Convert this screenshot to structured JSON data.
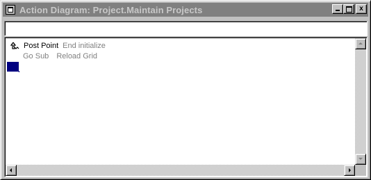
{
  "window": {
    "title": "Action Diagram: Project.Maintain Projects",
    "system_menu_icon": "window-system-menu-icon",
    "controls": {
      "minimize_icon": "minimize-icon",
      "maximize_icon": "maximize-icon",
      "close_label": "x"
    }
  },
  "command_input": {
    "value": "",
    "placeholder": ""
  },
  "diagram": {
    "lines": [
      {
        "icon": "post-point-arrow-icon",
        "command": "Post Point",
        "argument": "End initialize"
      },
      {
        "icon": "",
        "command": "Go Sub",
        "argument": "Reload Grid"
      }
    ],
    "selected_line_color": "#000080"
  },
  "colors": {
    "window_bg": "#c0c0c0",
    "titlebar_inactive": "#808080",
    "title_text": "#c8c8c8",
    "command_text": "#000000",
    "argument_text": "#808080"
  }
}
